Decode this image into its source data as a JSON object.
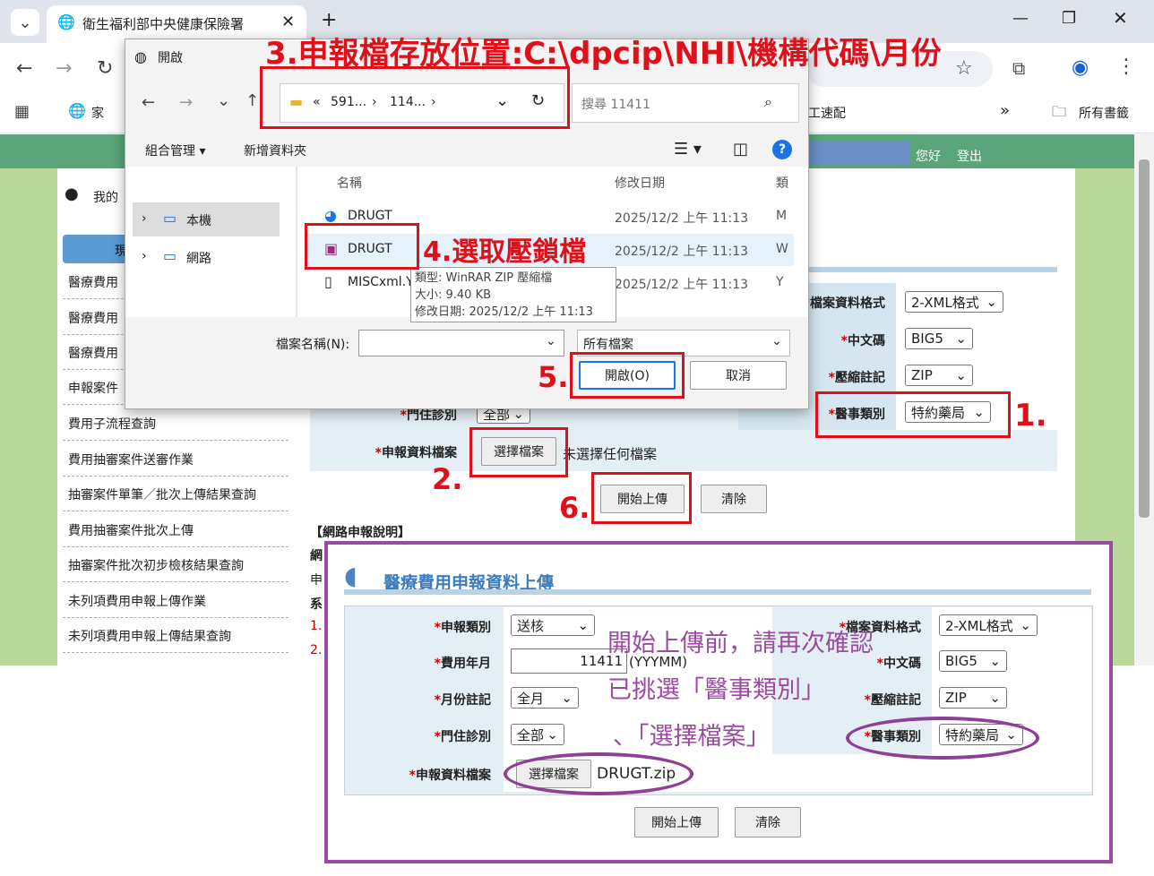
{
  "browser": {
    "tab_title": "衛生福利部中央健康保險署",
    "bookmarks": {
      "home": "家",
      "item": "工速配",
      "more": "»",
      "all": "所有書籤"
    }
  },
  "page": {
    "greeting": "您好",
    "logout": "登出",
    "my_prefix": "我的",
    "side_tab": "現",
    "sidebar_items": [
      "醫療費用",
      "醫療費用",
      "醫療費用",
      "申報案件",
      "費用子流程查詢",
      "費用抽審案件送審作業",
      "抽審案件單筆／批次上傳結果查詢",
      "費用抽審案件批次上傳",
      "抽審案件批次初步檢核結果查詢",
      "未列項費用申報上傳作業",
      "未列項費用申報上傳結果查詢"
    ],
    "form": {
      "format_label": "檔案資料格式",
      "format_value": "2-XML格式",
      "encoding_label": "中文碼",
      "encoding_value": "BIG5",
      "compress_label": "壓縮註記",
      "compress_value": "ZIP",
      "medical_label": "醫事類別",
      "medical_value": "特約藥局",
      "clinic_label": "門住診別",
      "clinic_value": "全部",
      "file_label": "申報資料檔案",
      "choose_file": "選擇檔案",
      "no_file": "未選擇任何檔案",
      "upload": "開始上傳",
      "clear": "清除"
    },
    "notes_title": "【網路申報說明】",
    "notes_lines": [
      "網",
      "申",
      "系",
      "1.",
      "2."
    ]
  },
  "dialog": {
    "title": "開啟",
    "path": [
      "«",
      "591...",
      "›",
      "114...",
      "›"
    ],
    "search_placeholder": "搜尋 11411",
    "organize": "組合管理",
    "new_folder": "新增資料夾",
    "nav": [
      "本機",
      "網路"
    ],
    "col_name": "名稱",
    "col_date": "修改日期",
    "col_type": "類",
    "files": [
      {
        "name": "DRUGT",
        "date": "2025/12/2 上午 11:13",
        "type": "M"
      },
      {
        "name": "DRUGT",
        "date": "2025/12/2 上午 11:13",
        "type": "W"
      },
      {
        "name": "MISCxml.Y",
        "date": "2025/12/2 上午 11:13",
        "type": "Y"
      }
    ],
    "tooltip": [
      "類型: WinRAR ZIP 壓縮檔",
      "大小: 9.40 KB",
      "修改日期: 2025/12/2 上午 11:13"
    ],
    "filename_label": "檔案名稱(N):",
    "filetype": "所有檔案",
    "open": "開啟(O)",
    "cancel": "取消"
  },
  "annotations": {
    "step1": "1.",
    "step2": "2.",
    "step3": "3.申報檔存放位置:C:\\dpcip\\NHI\\機構代碼\\月份",
    "step4": "4.選取壓鎖檔",
    "step5": "5.",
    "step6": "6.",
    "inset_note": [
      "開始上傳前，請再次確認",
      "已挑選「醫事類別」",
      "、「選擇檔案」"
    ]
  },
  "inset": {
    "title": "醫療費用申報資料上傳",
    "type_label": "申報類別",
    "type_value": "送核",
    "month_label": "費用年月",
    "month_value": "11411",
    "month_hint": "(YYYMM)",
    "monthmark_label": "月份註記",
    "monthmark_value": "全月",
    "clinic_label": "門住診別",
    "clinic_value": "全部",
    "file_label": "申報資料檔案",
    "choose_file": "選擇檔案",
    "file_value": "DRUGT.zip",
    "format_label": "檔案資料格式",
    "format_value": "2-XML格式",
    "encoding_label": "中文碼",
    "encoding_value": "BIG5",
    "compress_label": "壓縮註記",
    "compress_value": "ZIP",
    "medical_label": "醫事類別",
    "medical_value": "特約藥局",
    "upload": "開始上傳",
    "clear": "清除"
  }
}
